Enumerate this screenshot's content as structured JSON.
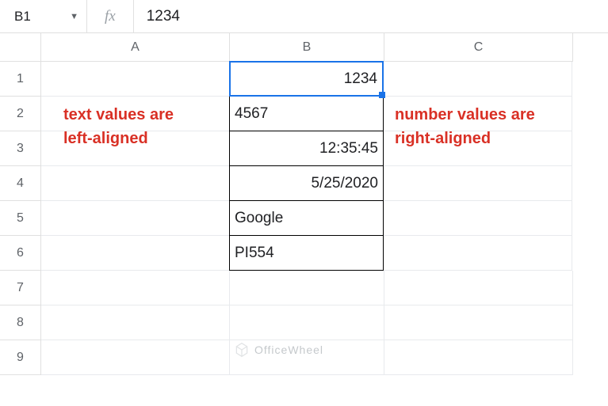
{
  "formula_bar": {
    "cell_ref": "B1",
    "fx_label": "fx",
    "value": "1234"
  },
  "columns": [
    "A",
    "B",
    "C"
  ],
  "rows": [
    "1",
    "2",
    "3",
    "4",
    "5",
    "6",
    "7",
    "8",
    "9"
  ],
  "cells": {
    "B1": {
      "value": "1234",
      "align": "right",
      "selected": true
    },
    "B2": {
      "value": "4567",
      "align": "left"
    },
    "B3": {
      "value": "12:35:45",
      "align": "right"
    },
    "B4": {
      "value": "5/25/2020",
      "align": "right"
    },
    "B5": {
      "value": "Google",
      "align": "left"
    },
    "B6": {
      "value": "PI554",
      "align": "left"
    }
  },
  "annotations": {
    "left": "text values are left-aligned",
    "right": "number values are right-aligned"
  },
  "watermark": "OfficeWheel"
}
